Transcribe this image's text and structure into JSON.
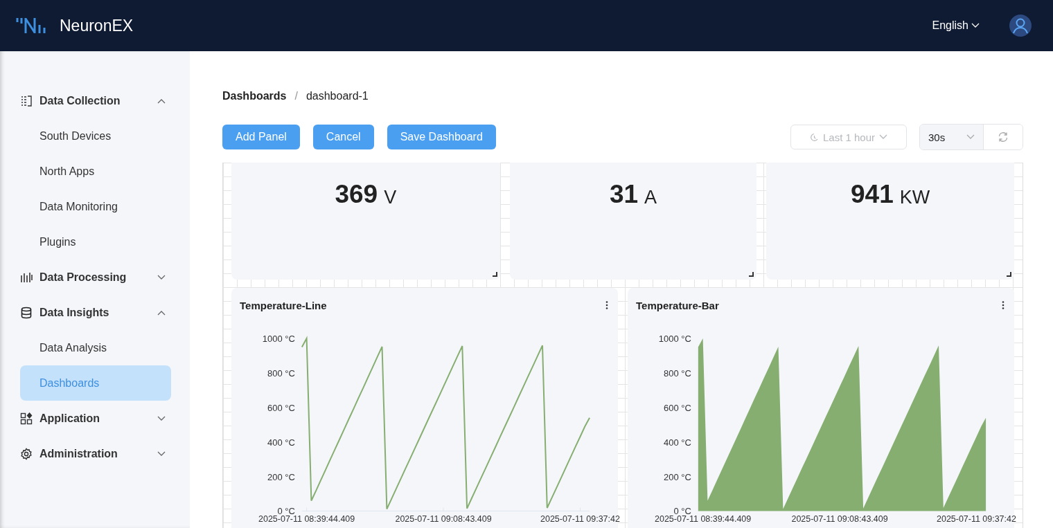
{
  "header": {
    "brand": "NeuronEX",
    "language": "English"
  },
  "sidebar": {
    "items": [
      {
        "label": "Data Collection",
        "expanded": true,
        "children": [
          {
            "label": "South Devices",
            "selected": false
          },
          {
            "label": "North Apps",
            "selected": false
          },
          {
            "label": "Data Monitoring",
            "selected": false
          },
          {
            "label": "Plugins",
            "selected": false
          }
        ]
      },
      {
        "label": "Data Processing",
        "expanded": false
      },
      {
        "label": "Data Insights",
        "expanded": true,
        "children": [
          {
            "label": "Data Analysis",
            "selected": false
          },
          {
            "label": "Dashboards",
            "selected": true
          }
        ]
      },
      {
        "label": "Application",
        "expanded": false
      },
      {
        "label": "Administration",
        "expanded": false
      }
    ]
  },
  "breadcrumb": {
    "items": [
      "Dashboards",
      "dashboard-1"
    ],
    "separator": "/"
  },
  "toolbar": {
    "buttons": [
      "Add Panel",
      "Cancel",
      "Save Dashboard"
    ],
    "time_range": {
      "value": "Last 1 hour",
      "disabled": true
    },
    "refresh_interval": "30s"
  },
  "stat_panels": [
    {
      "value": "369",
      "unit": "V"
    },
    {
      "value": "31",
      "unit": "A"
    },
    {
      "value": "941",
      "unit": "KW"
    }
  ],
  "chart_panels": [
    {
      "title": "Temperature-Line",
      "chart_data": {
        "type": "line",
        "categories": [
          null,
          "2025-07-11 08:39:44.409",
          null,
          null,
          null,
          null,
          null,
          null,
          null,
          null,
          null,
          null,
          null,
          null,
          null,
          null,
          null,
          null,
          null,
          null,
          null,
          null,
          null,
          null,
          null,
          null,
          null,
          null,
          null,
          null,
          "2025-07-11 09:08:43.409",
          null,
          null,
          null,
          null,
          null,
          null,
          null,
          null,
          null,
          null,
          null,
          null,
          null,
          null,
          null,
          null,
          null,
          null,
          null,
          null,
          null,
          null,
          null,
          null,
          null,
          null,
          null,
          null,
          "2025-07-11 09:37:42",
          null,
          null
        ],
        "series": [
          {
            "color": "#86ae70",
            "values": [
              950,
              1000,
              60,
              119,
              179,
              238,
              298,
              357,
              417,
              476,
              536,
              595,
              655,
              714,
              774,
              833,
              893,
              952,
              12,
              71,
              130,
              189,
              248,
              307,
              366,
              425,
              484,
              543,
              602,
              661,
              720,
              779,
              838,
              897,
              956,
              15,
              74,
              133,
              192,
              251,
              310,
              369,
              428,
              487,
              546,
              605,
              664,
              723,
              782,
              841,
              900,
              959,
              18,
              77,
              136,
              195,
              254,
              313,
              372,
              431,
              490,
              540
            ]
          }
        ],
        "ylim": [
          0,
          1000
        ],
        "yticks": [
          {
            "value": 0,
            "label": "0 °C"
          },
          {
            "value": 200,
            "label": "200 °C"
          },
          {
            "value": 400,
            "label": "400 °C"
          },
          {
            "value": 600,
            "label": "600 °C"
          },
          {
            "value": 800,
            "label": "800 °C"
          },
          {
            "value": 1000,
            "label": "1000 °C"
          }
        ]
      }
    },
    {
      "title": "Temperature-Bar",
      "chart_data": {
        "type": "area",
        "categories": [
          null,
          "2025-07-11 08:39:44.409",
          null,
          null,
          null,
          null,
          null,
          null,
          null,
          null,
          null,
          null,
          null,
          null,
          null,
          null,
          null,
          null,
          null,
          null,
          null,
          null,
          null,
          null,
          null,
          null,
          null,
          null,
          null,
          null,
          "2025-07-11 09:08:43.409",
          null,
          null,
          null,
          null,
          null,
          null,
          null,
          null,
          null,
          null,
          null,
          null,
          null,
          null,
          null,
          null,
          null,
          null,
          null,
          null,
          null,
          null,
          null,
          null,
          null,
          null,
          null,
          null,
          "2025-07-11 09:37:42",
          null,
          null
        ],
        "series": [
          {
            "color": "#86ae70",
            "values": [
              950,
              1000,
              60,
              119,
              179,
              238,
              298,
              357,
              417,
              476,
              536,
              595,
              655,
              714,
              774,
              833,
              893,
              952,
              12,
              71,
              130,
              189,
              248,
              307,
              366,
              425,
              484,
              543,
              602,
              661,
              720,
              779,
              838,
              897,
              956,
              15,
              74,
              133,
              192,
              251,
              310,
              369,
              428,
              487,
              546,
              605,
              664,
              723,
              782,
              841,
              900,
              959,
              18,
              77,
              136,
              195,
              254,
              313,
              372,
              431,
              490,
              540
            ]
          }
        ],
        "ylim": [
          0,
          1000
        ],
        "yticks": [
          {
            "value": 0,
            "label": "0 °C"
          },
          {
            "value": 200,
            "label": "200 °C"
          },
          {
            "value": 400,
            "label": "400 °C"
          },
          {
            "value": 600,
            "label": "600 °C"
          },
          {
            "value": 800,
            "label": "800 °C"
          },
          {
            "value": 1000,
            "label": "1000 °C"
          }
        ]
      }
    }
  ]
}
